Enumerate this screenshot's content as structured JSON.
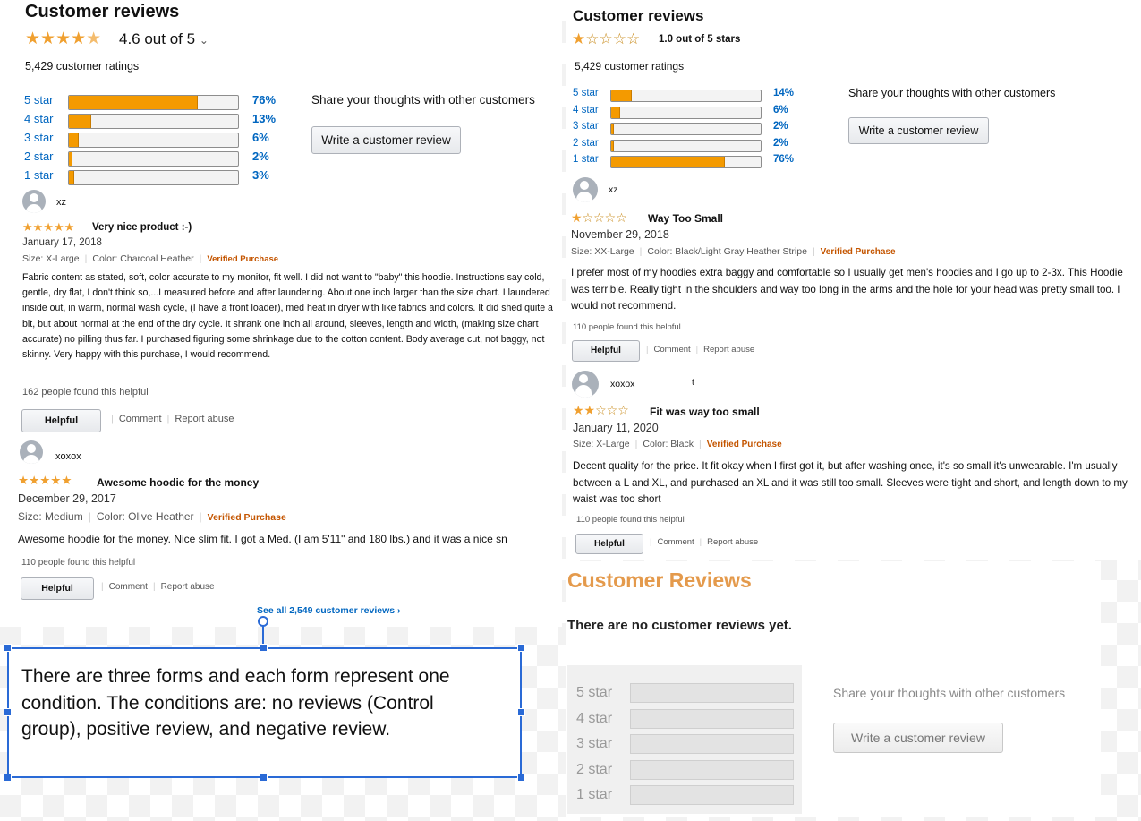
{
  "colors": {
    "accent_bar": "#f49a00",
    "link": "#0066c0",
    "verified": "#c45500",
    "selection": "#2a6ad6",
    "no_review_title": "#e49a4c"
  },
  "form_positive": {
    "title": "Customer reviews",
    "rating_text": "4.6 out of 5",
    "rating_value": 4.6,
    "ratings_count": "5,429 customer ratings",
    "histogram": [
      {
        "label": "5 star",
        "percent": "76%",
        "value": 76
      },
      {
        "label": "4 star",
        "percent": "13%",
        "value": 13
      },
      {
        "label": "3 star",
        "percent": "6%",
        "value": 6
      },
      {
        "label": "2 star",
        "percent": "2%",
        "value": 2
      },
      {
        "label": "1 star",
        "percent": "3%",
        "value": 3
      }
    ],
    "share_text": "Share your thoughts with other customers",
    "write_review": "Write a customer review",
    "reviews": [
      {
        "author": "xz",
        "rating": 5,
        "headline": "Very nice product :-)",
        "date": "January 17, 2018",
        "size": "Size: X-Large",
        "color": "Color: Charcoal Heather",
        "verified": "Verified Purchase",
        "body": "Fabric content as stated, soft, color accurate to my monitor, fit well. I did not want to \"baby\" this hoodie. Instructions say cold, gentle, dry flat, I don't think so,...I measured before and after laundering. About one inch larger than the size chart. I laundered inside out, in warm, normal wash cycle, (I have a front loader), med heat in dryer with like fabrics and colors. It did shed quite a bit, but about normal at the end of the dry cycle. It shrank one inch all around, sleeves, length and width, (making size chart accurate) no pilling thus far. I purchased figuring some shrinkage due to the cotton content. Body average cut, not baggy, not skinny. Very happy with this purchase, I would recommend.",
        "helpful_count": "162 people found this helpful",
        "helpful": "Helpful",
        "comment": "Comment",
        "report": "Report abuse"
      },
      {
        "author": "xoxox",
        "rating": 5,
        "headline": "Awesome hoodie for the money",
        "date": "December 29, 2017",
        "size": "Size: Medium",
        "color": "Color: Olive Heather",
        "verified": "Verified Purchase",
        "body": "Awesome hoodie for the money. Nice slim fit. I got a Med. (I am 5'11\" and 180 lbs.) and it was a nice sn",
        "helpful_count": "110 people found this helpful",
        "helpful": "Helpful",
        "comment": "Comment",
        "report": "Report abuse"
      }
    ],
    "see_all": "See all 2,549 customer reviews ›"
  },
  "form_negative": {
    "title": "Customer reviews",
    "rating_text": "1.0 out of 5 stars",
    "rating_value": 1.0,
    "ratings_count": "5,429 customer ratings",
    "histogram": [
      {
        "label": "5 star",
        "percent": "14%",
        "value": 14
      },
      {
        "label": "4 star",
        "percent": "6%",
        "value": 6
      },
      {
        "label": "3 star",
        "percent": "2%",
        "value": 2
      },
      {
        "label": "2 star",
        "percent": "2%",
        "value": 2
      },
      {
        "label": "1 star",
        "percent": "76%",
        "value": 76
      }
    ],
    "share_text": "Share your thoughts with other customers",
    "write_review": "Write a customer review",
    "reviews": [
      {
        "author": "xz",
        "rating": 1,
        "headline": "Way Too Small",
        "date": "November 29, 2018",
        "size": "Size: XX-Large",
        "color": "Color: Black/Light Gray Heather Stripe",
        "verified": "Verified Purchase",
        "body": "I prefer most of my hoodies extra baggy and comfortable so I usually get men's hoodies and I go up to 2-3x. This Hoodie was terrible. Really tight in the shoulders and way too long in the arms and the hole for your head was pretty small too. I would not recommend.",
        "helpful_count": "110 people found this helpful",
        "helpful": "Helpful",
        "comment": "Comment",
        "report": "Report abuse"
      },
      {
        "author": "xoxox",
        "author_extra": "t",
        "rating": 2,
        "headline": "Fit was way too small",
        "date": "January 11, 2020",
        "size": "Size: X-Large",
        "color": "Color: Black",
        "verified": "Verified Purchase",
        "body": "Decent quality for the price. It fit okay when I first got it, but after washing once, it's so small it's unwearable. I'm usually between a L and XL, and purchased an XL and it was still too small. Sleeves were tight and short, and length down to my waist was too short",
        "helpful_count": "110 people found this helpful",
        "helpful": "Helpful",
        "comment": "Comment",
        "report": "Report abuse"
      }
    ]
  },
  "form_control": {
    "title": "Customer Reviews",
    "no_reviews": "There are no customer reviews yet.",
    "histogram_labels": [
      "5 star",
      "4 star",
      "3 star",
      "2 star",
      "1 star"
    ],
    "share_text": "Share your thoughts with other customers",
    "write_review": "Write a customer review"
  },
  "annotation": {
    "text": "There are three forms and each form represent one condition. The conditions are: no reviews (Control group), positive review, and negative review."
  }
}
